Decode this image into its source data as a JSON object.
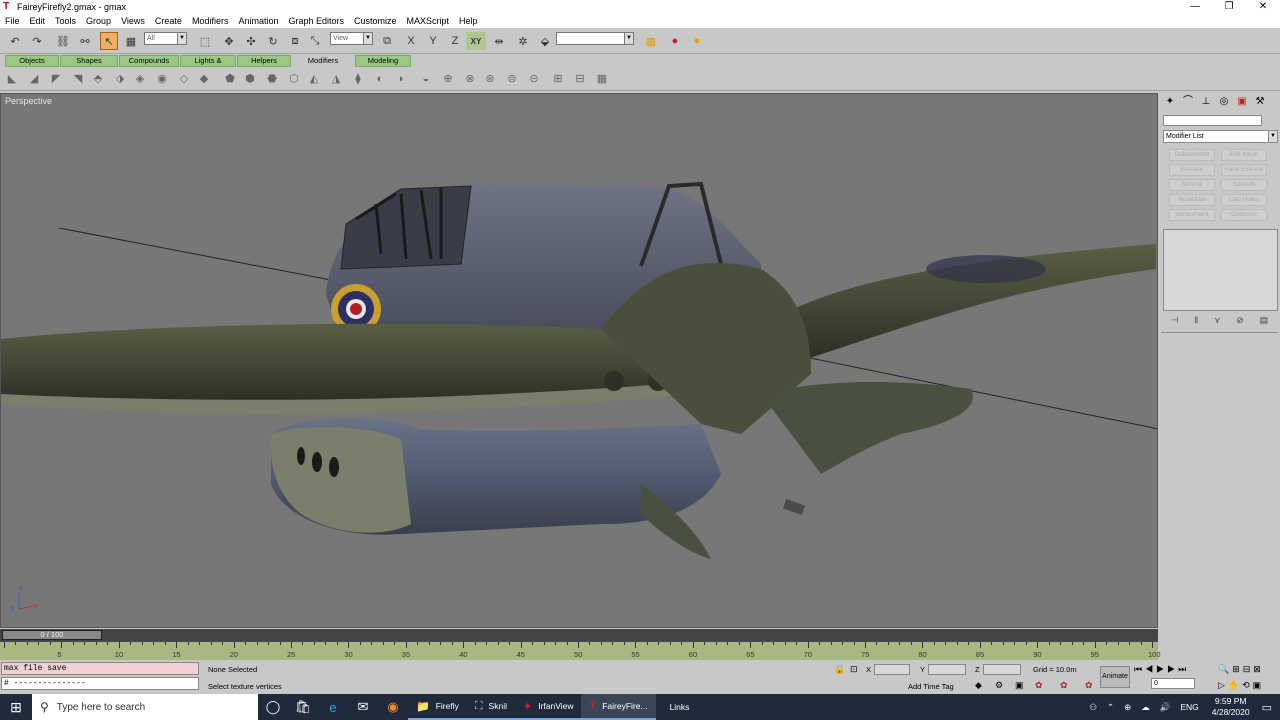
{
  "window": {
    "title": "FaireyFirefly2.gmax - gmax",
    "minimize": "—",
    "maximize": "❐",
    "close": "✕"
  },
  "menu": [
    "File",
    "Edit",
    "Tools",
    "Group",
    "Views",
    "Create",
    "Modifiers",
    "Animation",
    "Graph Editors",
    "Customize",
    "MAXScript",
    "Help"
  ],
  "toolbar": {
    "selection_filter": "All",
    "ref_coord": "View",
    "axis_xy": "XY"
  },
  "tabs": [
    {
      "label": "Objects",
      "active": false
    },
    {
      "label": "Shapes",
      "active": false
    },
    {
      "label": "Compounds",
      "active": false
    },
    {
      "label": "Lights & Cameras",
      "active": false
    },
    {
      "label": "Helpers",
      "active": false
    },
    {
      "label": "Modifiers",
      "active": true
    },
    {
      "label": "Modeling",
      "active": false
    }
  ],
  "viewport": {
    "label": "Perspective"
  },
  "command_panel": {
    "modifier_list": "Modifier List",
    "buttons": [
      "DeleteMesh",
      "Edit Mesh",
      "Extrude",
      "Face Extrude",
      "Normal",
      "Smooth",
      "Tessellate",
      "Cap Holes",
      "VertexPaint",
      "Optimize"
    ]
  },
  "timeline": {
    "slider": "0 / 100",
    "ticks": [
      "5",
      "10",
      "15",
      "20",
      "25",
      "30",
      "35",
      "40",
      "45",
      "50",
      "55",
      "60",
      "65",
      "70",
      "75",
      "80",
      "85",
      "90",
      "95",
      "100"
    ],
    "tick_values": [
      5,
      10,
      15,
      20,
      25,
      30,
      35,
      40,
      45,
      50,
      55,
      60,
      65,
      70,
      75,
      80,
      85,
      90,
      95,
      100
    ],
    "range_max": 100
  },
  "status": {
    "script_line1": "max file save",
    "script_line2": "# ---------------",
    "selection": "None Selected",
    "prompt": "Select texture vertices",
    "x_label": "X",
    "y_label": "Y",
    "z_label": "Z",
    "grid": "Grid = 10.0m",
    "add_time_tag": "Add Time Tag",
    "animate": "Animate",
    "frame": "0"
  },
  "taskbar": {
    "search_placeholder": "Type here to search",
    "apps": [
      {
        "label": "Firefly",
        "icon": "folder-icon",
        "active": false
      },
      {
        "label": "Sknil",
        "icon": "sknil-icon",
        "active": false
      },
      {
        "label": "IrfanView",
        "icon": "irfanview-icon",
        "active": false
      },
      {
        "label": "FaireyFire...",
        "icon": "gmax-icon",
        "active": true
      }
    ],
    "links": "Links",
    "language": "ENG",
    "time": "9:59 PM",
    "date": "4/28/2020"
  }
}
